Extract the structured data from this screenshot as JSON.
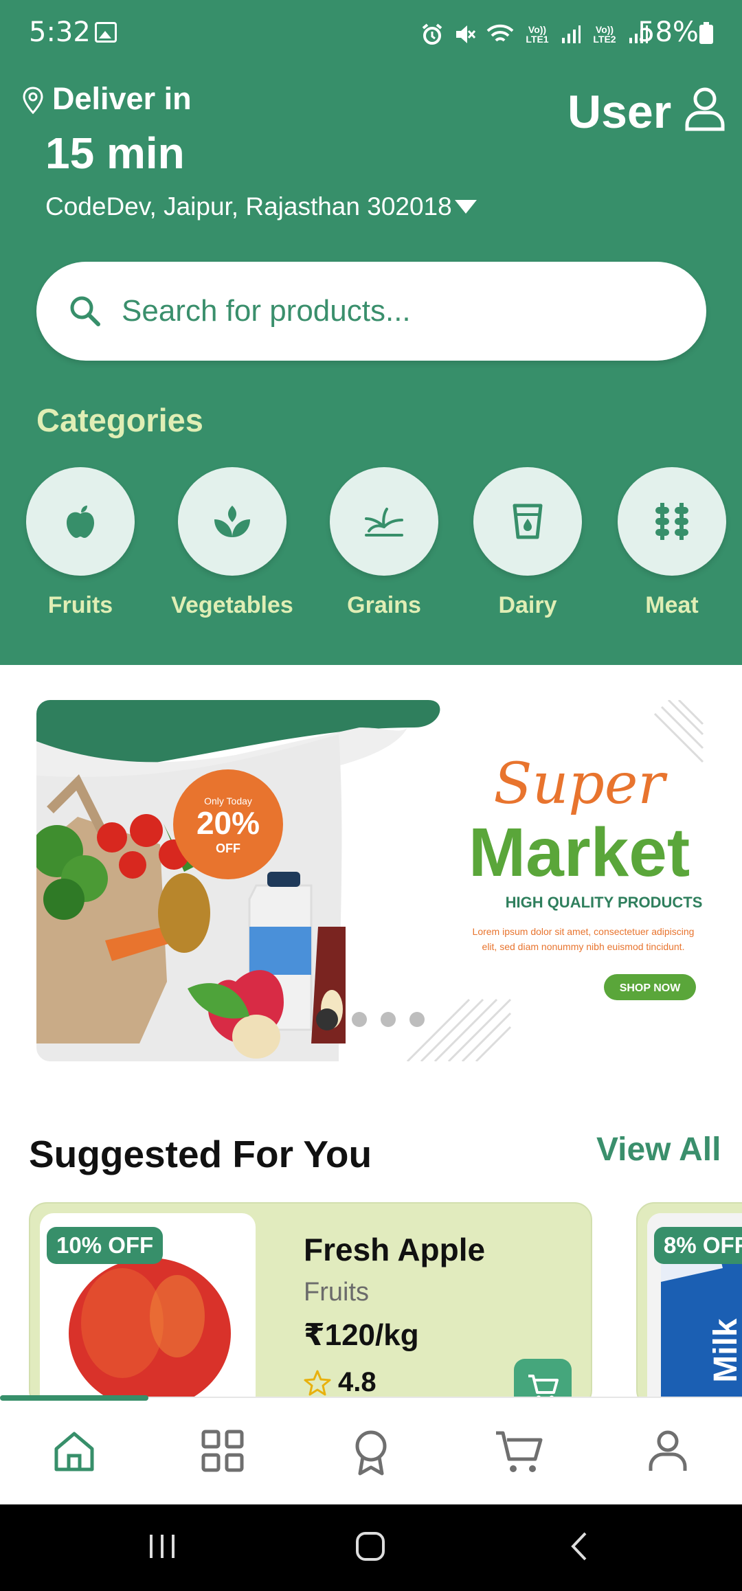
{
  "status_bar": {
    "time": "5:32",
    "battery": "58%",
    "sim1": "Vo)) LTE1",
    "sim2": "Vo)) LTE2"
  },
  "header": {
    "deliver_label": "Deliver in",
    "deliver_time": "15 min",
    "address": "CodeDev, Jaipur, Rajasthan 302018",
    "user_label": "User"
  },
  "search": {
    "placeholder": "Search for products..."
  },
  "categories": {
    "title": "Categories",
    "items": [
      {
        "label": "Fruits",
        "icon": "apple-icon"
      },
      {
        "label": "Vegetables",
        "icon": "sprout-icon"
      },
      {
        "label": "Grains",
        "icon": "grain-icon"
      },
      {
        "label": "Dairy",
        "icon": "milk-glass-icon"
      },
      {
        "label": "Meat",
        "icon": "meat-icon"
      }
    ]
  },
  "banner": {
    "tag_small": "Only Today",
    "discount": "20%",
    "discount_suffix": "OFF",
    "title_script": "Super",
    "title_main": "Market",
    "subtitle": "HIGH QUALITY PRODUCTS",
    "body_line1": "Lorem ipsum dolor sit amet, consectetuer adipiscing",
    "body_line2": "elit, sed diam nonummy nibh euismod tincidunt.",
    "cta": "SHOP NOW",
    "slide_count": 4,
    "active_slide": 1
  },
  "suggested": {
    "title": "Suggested For You",
    "view_all": "View All",
    "products": [
      {
        "badge": "10% OFF",
        "name": "Fresh Apple",
        "category": "Fruits",
        "price": "₹120/kg",
        "rating": "4.8"
      },
      {
        "badge": "8% OFF",
        "label": "Milk"
      }
    ]
  },
  "bottom_nav": {
    "items": [
      "home-icon",
      "grid-icon",
      "badge-icon",
      "cart-icon",
      "profile-icon"
    ],
    "active": "home-icon"
  },
  "colors": {
    "primary": "#378f6a",
    "category_text": "#e0eeb5",
    "card_bg": "#e1ebbe",
    "banner_orange": "#e8742e",
    "banner_green": "#5aa63a"
  }
}
